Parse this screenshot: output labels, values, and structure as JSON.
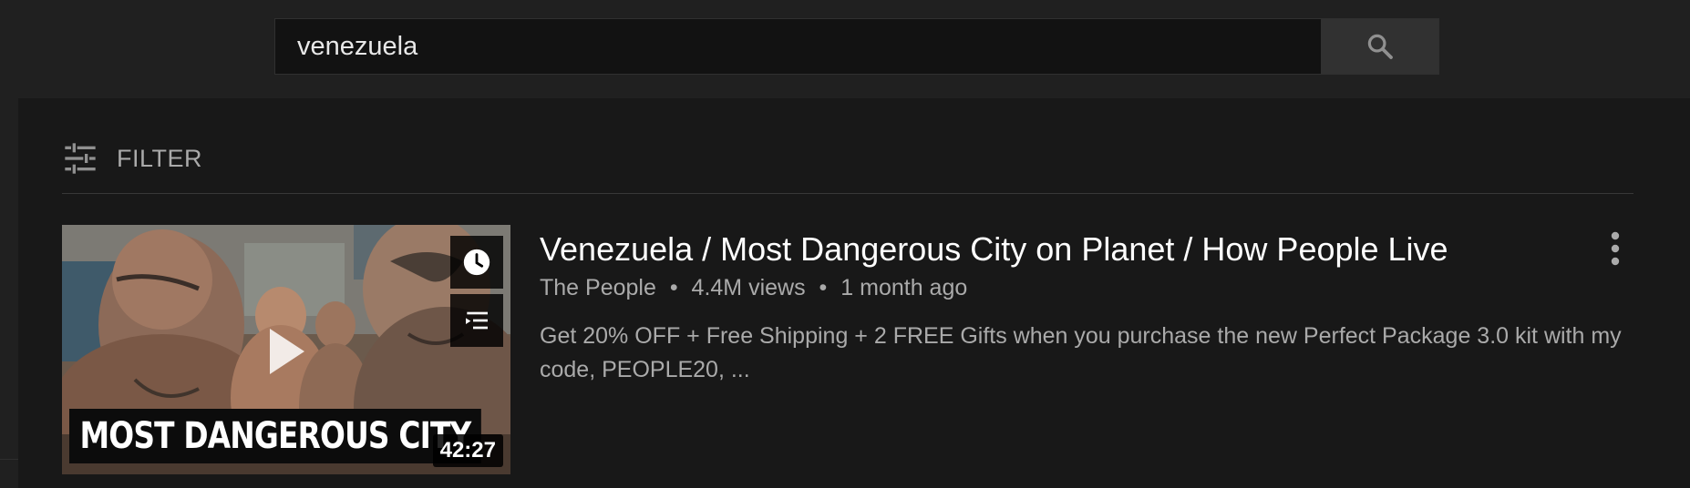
{
  "search": {
    "query": "venezuela",
    "icon": "search-icon"
  },
  "filter": {
    "label": "FILTER",
    "icon": "tune-sliders-icon"
  },
  "result": {
    "title": "Venezuela / Most Dangerous City on Planet / How People Live",
    "channel": "The People",
    "views": "4.4M views",
    "age": "1 month ago",
    "separator": "•",
    "description": "Get 20% OFF + Free Shipping + 2 FREE Gifts when you purchase the new Perfect Package 3.0 kit with my code, PEOPLE20, ...",
    "thumbnail": {
      "caption": "MOST DANGEROUS CITY",
      "duration": "42:27",
      "watch_later_icon": "clock-icon",
      "add_to_queue_icon": "queue-icon",
      "play_icon": "play-icon"
    },
    "menu_icon": "more-vert-icon"
  },
  "colors": {
    "page_background": "#181818",
    "header_background": "#202020",
    "search_field": "#121212",
    "search_button": "#313131",
    "primary_text": "#ffffff",
    "secondary_text": "#aaaaaa"
  }
}
